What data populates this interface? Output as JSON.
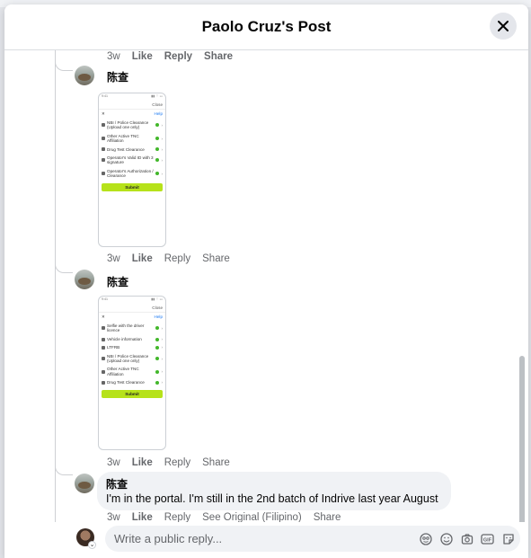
{
  "header": {
    "title": "Paolo Cruz's Post"
  },
  "top_actions": [
    "3w",
    "Like",
    "Reply",
    "Share"
  ],
  "comments": [
    {
      "name": "陈查",
      "image": {
        "status_left": "9:41",
        "status_right": "▮▮ ⌔ ▭",
        "close": "Close",
        "x": "✕",
        "help": "Help",
        "items": [
          "NBI / Police Clearance (Upload one only)",
          "Other Active TNC Affiliation",
          "Drug Test Clearance",
          "Operator's Valid ID with 3 signature",
          "Operator's Authorization / Clearance"
        ],
        "submit": "Submit"
      },
      "actions": [
        "3w",
        "Like",
        "Reply",
        "Share"
      ]
    },
    {
      "name": "陈查",
      "image": {
        "status_left": "9:41",
        "status_right": "▮▮ ⌔ ▭",
        "close": "Close",
        "x": "✕",
        "help": "Help",
        "items": [
          "Selfie with the driver licence",
          "Vehicle information",
          "LTFRB",
          "NBI / Police Clearance (Upload one only)",
          "Other Active TNC Affiliation",
          "Drug Test Clearance"
        ],
        "submit": "Submit"
      },
      "actions": [
        "3w",
        "Like",
        "Reply",
        "Share"
      ]
    },
    {
      "name": "陈查",
      "text": "I'm in the portal. I'm still in the 2nd batch of Indrive last year August",
      "actions": [
        "3w",
        "Like",
        "Reply",
        "See Original (Filipino)",
        "Share"
      ]
    }
  ],
  "reply": {
    "placeholder": "Write a public reply..."
  },
  "reply_icons": [
    "avatar-sticker-icon",
    "emoji-icon",
    "camera-icon",
    "gif-icon",
    "sticker-icon"
  ]
}
